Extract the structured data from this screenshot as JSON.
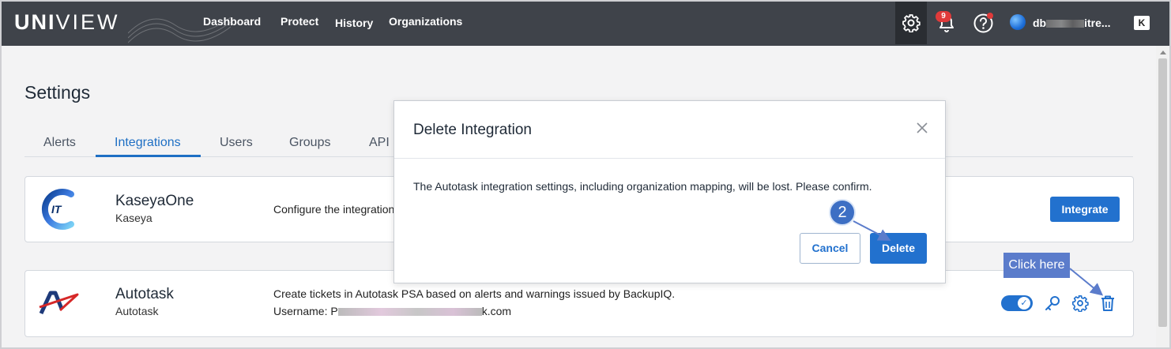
{
  "app": {
    "logo_bold": "UNI",
    "logo_thin": "VIEW"
  },
  "nav": {
    "items": [
      {
        "label": "Dashboard"
      },
      {
        "label": "Protect"
      },
      {
        "label": "History"
      },
      {
        "label": "Organizations"
      }
    ],
    "notifications_count": "9",
    "user": {
      "name_prefix": "db",
      "name_suffix": "itre..."
    },
    "brand_badge": "K"
  },
  "page": {
    "title": "Settings",
    "tabs": [
      {
        "label": "Alerts"
      },
      {
        "label": "Integrations",
        "active": true
      },
      {
        "label": "Users"
      },
      {
        "label": "Groups"
      },
      {
        "label": "API ."
      }
    ]
  },
  "integrations": [
    {
      "name": "KaseyaOne",
      "vendor": "Kaseya",
      "description": "Configure the integration",
      "action_label": "Integrate"
    },
    {
      "name": "Autotask",
      "vendor": "Autotask",
      "description": "Create tickets in Autotask PSA based on alerts and warnings issued by BackupIQ.",
      "username_label": "Username:",
      "username_prefix": "P",
      "username_domain_tail": "k.com",
      "enabled": true
    }
  ],
  "dialog": {
    "title": "Delete Integration",
    "body": "The Autotask integration settings, including organization mapping, will be lost. Please confirm.",
    "cancel_label": "Cancel",
    "delete_label": "Delete"
  },
  "annotations": {
    "step_number": "2",
    "callout": "Click here"
  },
  "colors": {
    "topbar": "#3f434a",
    "primary": "#2271ce",
    "annotation": "#5b7ccb"
  }
}
